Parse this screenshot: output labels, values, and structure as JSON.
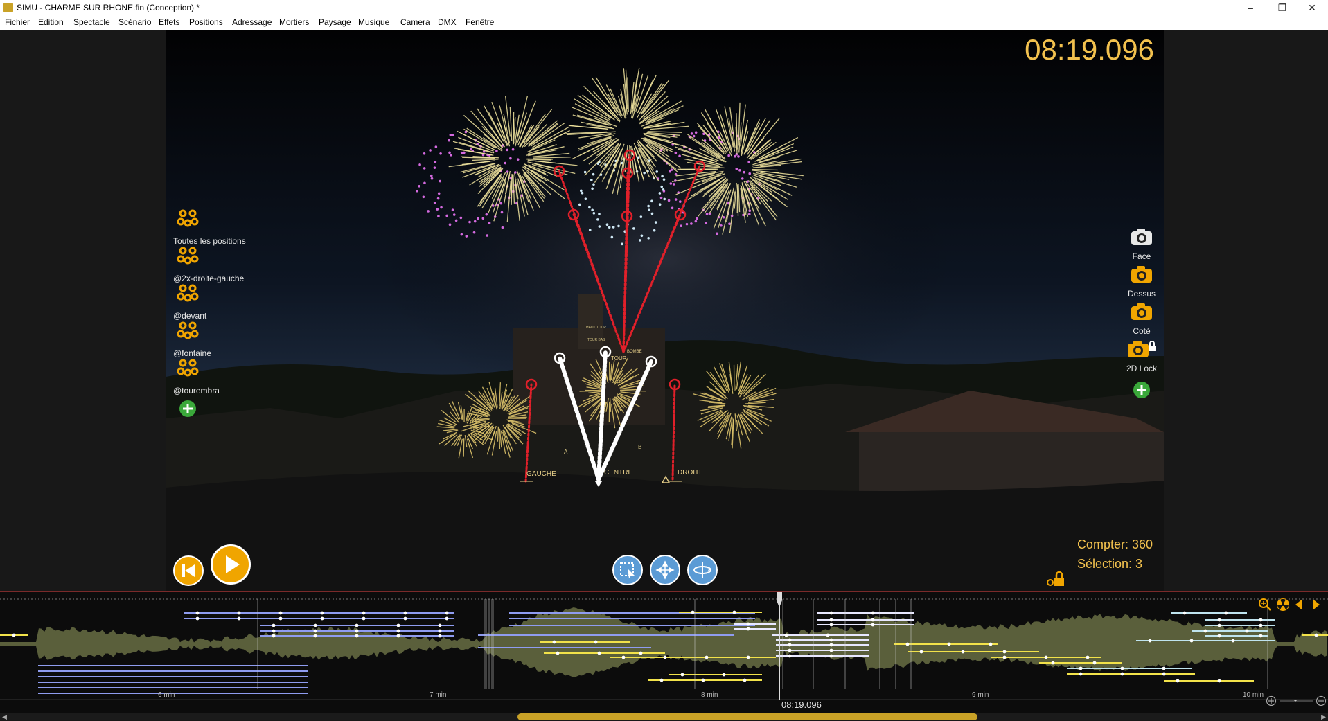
{
  "window": {
    "title": "SIMU - CHARME SUR RHONE.fin (Conception) *",
    "controls": [
      "minimize-icon",
      "restore-icon",
      "close-icon"
    ]
  },
  "menu": [
    "Fichier",
    "Edition",
    "Spectacle",
    "Scénario",
    "Effets",
    "Positions",
    "Adressage",
    "Mortiers",
    "Paysage",
    "Musique",
    "Camera",
    "DMX",
    "Fenêtre"
  ],
  "viewport": {
    "timer": "08:19.096",
    "position_groups": [
      {
        "label": "Toutes les positions"
      },
      {
        "label": "@2x-droite-gauche"
      },
      {
        "label": "@devant"
      },
      {
        "label": "@fontaine"
      },
      {
        "label": "@tourembra"
      }
    ],
    "cameras": [
      {
        "label": "Face",
        "icon": "camera-icon",
        "color": "#e8e8e8"
      },
      {
        "label": "Dessus",
        "icon": "camera-icon",
        "color": "#f0a500"
      },
      {
        "label": "Coté",
        "icon": "camera-icon",
        "color": "#f0a500"
      },
      {
        "label": "2D Lock",
        "icon": "camera-lock-icon",
        "color": "#f0a500"
      }
    ],
    "scene_labels": {
      "gauche": "GAUCHE",
      "centre": "CENTRE",
      "droite": "DROITE",
      "tour": "TOUR",
      "bombe": "BOMBE",
      "haut_tour": "HAUT TOUR",
      "tour_bas": "TOUR BAS",
      "a": "A",
      "b": "B"
    },
    "stats": {
      "count": "Compter: 360",
      "selection": "Sélection: 3"
    }
  },
  "timeline": {
    "cursor_time": "08:19.096",
    "minute_labels": [
      "6 min",
      "7 min",
      "8 min",
      "9 min",
      "10 min"
    ]
  },
  "colors": {
    "accent": "#f2c14e",
    "orange": "#f0a500",
    "selection_red": "#e0202a",
    "timeline_blue": "#8f9cf0",
    "timeline_yellow": "#f2e24a",
    "waveform": "#6e7447",
    "add_green": "#3aa83a"
  }
}
